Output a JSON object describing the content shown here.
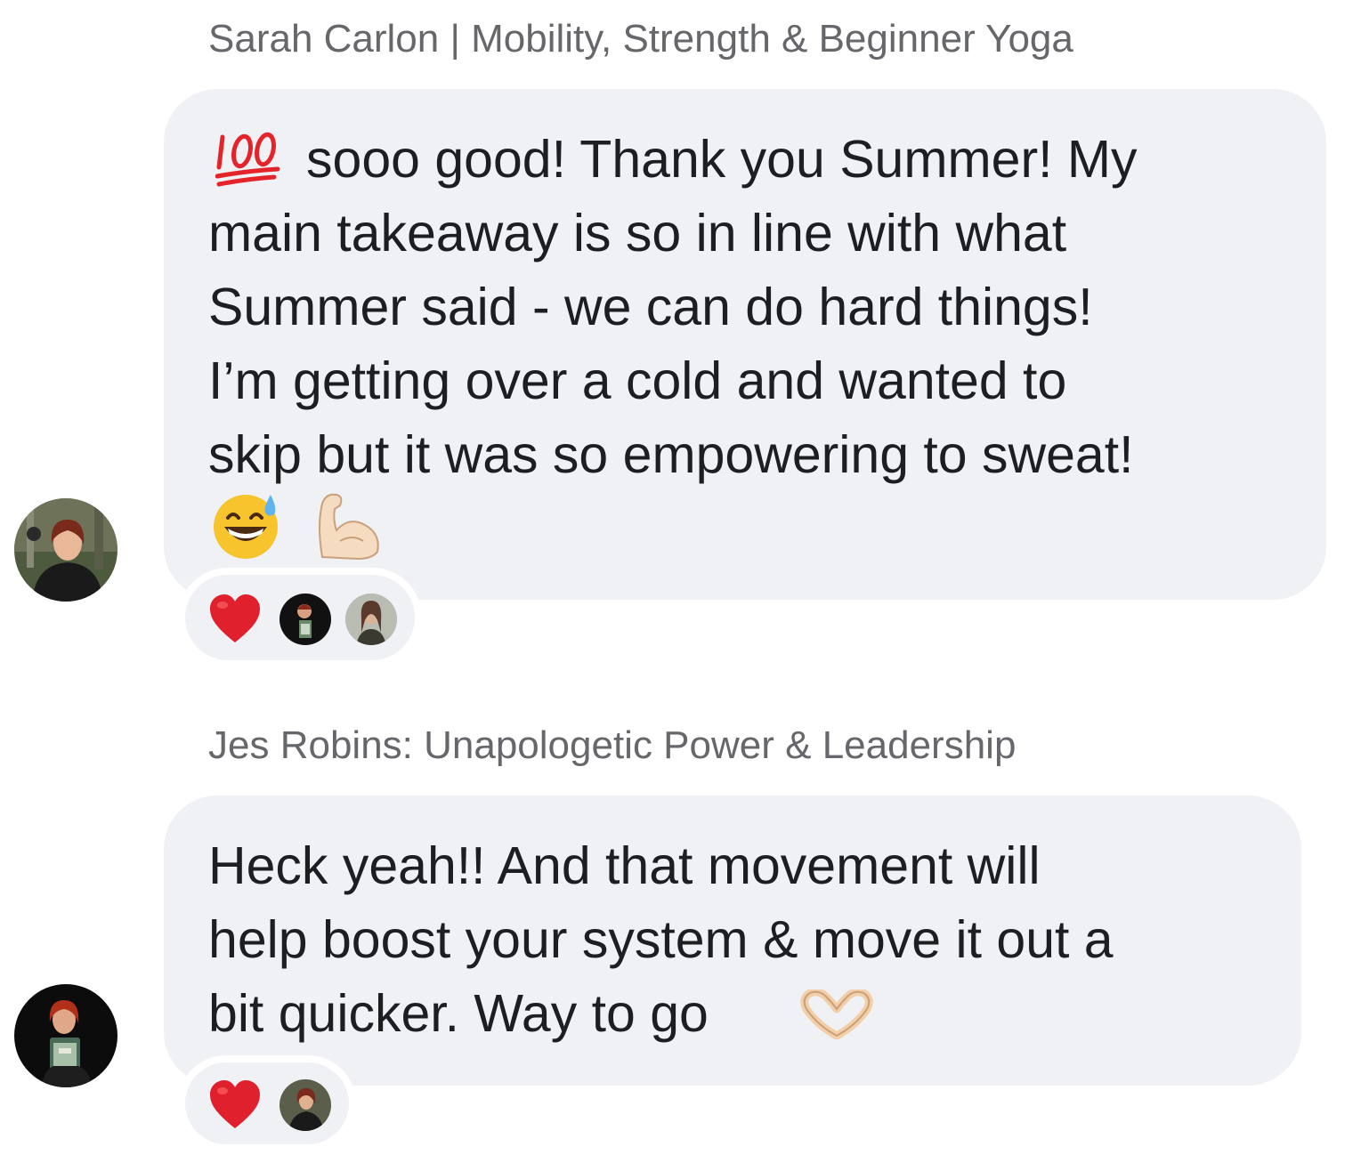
{
  "messages": [
    {
      "sender": "Sarah Carlon | Mobility, Strength & Beginner Yoga",
      "lines": [
        "sooo good! Thank you Summer! My",
        "main takeaway is so in line with what",
        "Summer said - we can do hard things!",
        "I’m getting over a cold and wanted to",
        "skip but it was so empowering to sweat!"
      ],
      "emojis": [
        "hundred-points-icon",
        "grinning-sweat-icon",
        "flexed-biceps-icon"
      ],
      "reactions": [
        "heart-icon",
        "reactor-avatar-1",
        "reactor-avatar-2"
      ]
    },
    {
      "sender": "Jes Robins: Unapologetic Power & Leadership",
      "lines": [
        "Heck yeah!! And that movement will",
        "help boost your system & move it out a",
        "bit quicker. Way to go"
      ],
      "emojis": [
        "heart-hands-icon"
      ],
      "reactions": [
        "heart-icon",
        "reactor-avatar-1"
      ]
    }
  ],
  "colors": {
    "bubble": "#f0f1f4",
    "sender": "#65676b",
    "text": "#1c1e21",
    "heart": "#e0202c"
  }
}
